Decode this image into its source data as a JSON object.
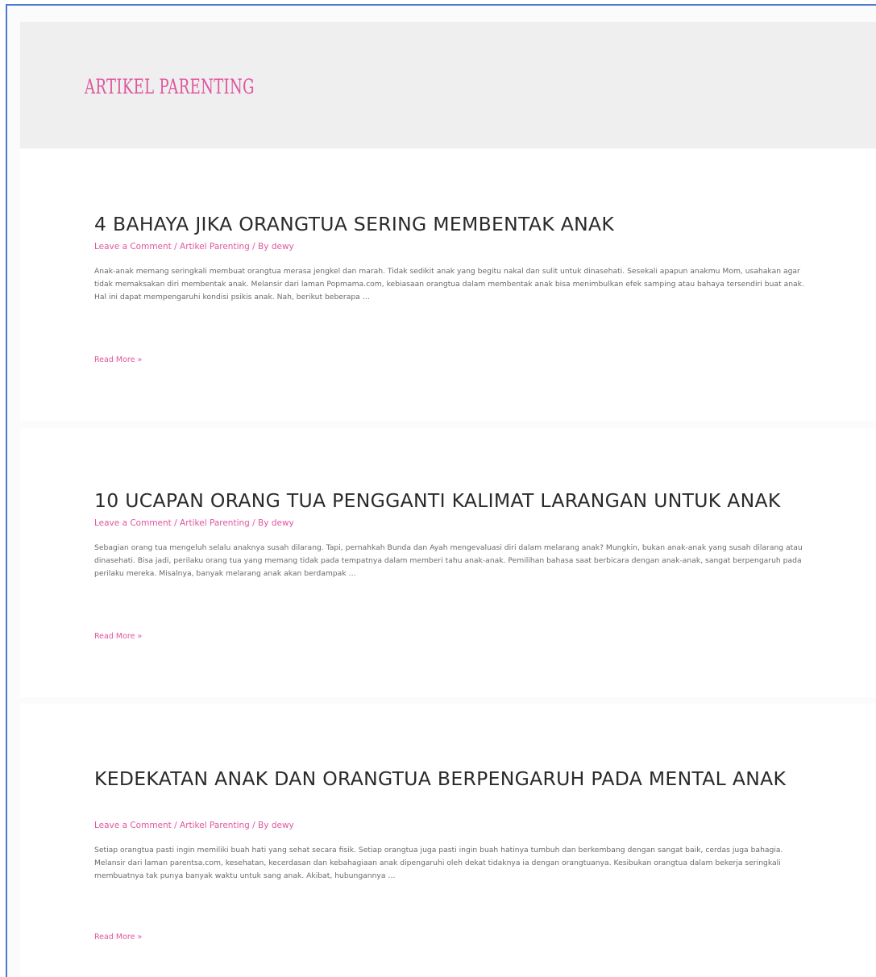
{
  "archive": {
    "title": "ARTIKEL PARENTING"
  },
  "articles": [
    {
      "title": "4 BAHAYA JIKA ORANGTUA SERING MEMBENTAK ANAK",
      "meta": {
        "comments": "Leave a Comment",
        "separator": " / ",
        "category": "Artikel Parenting",
        "by": "By ",
        "author": "dewy"
      },
      "excerpt": " Anak-anak memang seringkali membuat orangtua merasa jengkel dan marah. Tidak sedikit anak yang begitu nakal dan sulit untuk dinasehati. Sesekali apapun anakmu Mom, usahakan agar tidak memaksakan diri membentak anak. Melansir dari laman Popmama.com, kebiasaan orangtua dalam membentak anak bisa menimbulkan efek samping atau bahaya tersendiri buat anak. Hal ini dapat mempengaruhi kondisi psikis anak. Nah, berikut beberapa …",
      "read_more": "Read More »"
    },
    {
      "title": "10 UCAPAN ORANG TUA PENGGANTI KALIMAT LARANGAN UNTUK ANAK",
      "meta": {
        "comments": "Leave a Comment",
        "separator": " / ",
        "category": "Artikel Parenting",
        "by": "By ",
        "author": "dewy"
      },
      "excerpt": "Sebagian orang tua mengeluh selalu anaknya susah dilarang. Tapi, pernahkah Bunda dan Ayah mengevaluasi diri dalam melarang anak? Mungkin, bukan anak-anak yang susah dilarang atau dinasehati. Bisa jadi, perilaku orang tua yang memang tidak pada tempatnya dalam memberi tahu anak-anak. Pemilihan bahasa saat berbicara dengan anak-anak, sangat berpengaruh pada perilaku mereka. Misalnya, banyak melarang anak akan berdampak …",
      "read_more": "Read More »"
    },
    {
      "title": "KEDEKATAN ANAK DAN ORANGTUA BERPENGARUH PADA MENTAL ANAK",
      "meta": {
        "comments": "Leave a Comment",
        "separator": " / ",
        "category": "Artikel Parenting",
        "by": "By ",
        "author": "dewy"
      },
      "excerpt": "Setiap orangtua pasti ingin memiliki buah hati yang sehat secara fisik. Setiap orangtua juga pasti ingin buah hatinya tumbuh dan berkembang dengan sangat baik, cerdas juga bahagia. Melansir dari laman parentsa.com, kesehatan, kecerdasan dan kebahagiaan anak dipengaruhi oleh dekat tidaknya ia dengan orangtuanya. Kesibukan orangtua dalam bekerja seringkali membuatnya tak punya banyak waktu untuk sang anak. Akibat, hubungannya …",
      "read_more": "Read More »"
    }
  ],
  "colors": {
    "accent": "#e0559f",
    "title_text": "#2a2a2a",
    "body_text": "#6a6a6a",
    "header_band": "#efefef",
    "frame_border": "#4a7bd0"
  }
}
